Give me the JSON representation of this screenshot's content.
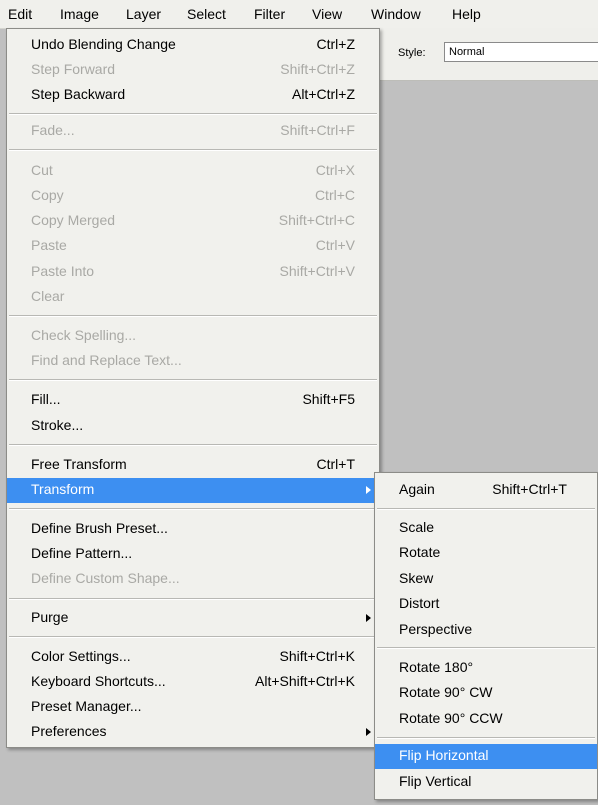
{
  "menubar": [
    "Edit",
    "Image",
    "Layer",
    "Select",
    "Filter",
    "View",
    "Window",
    "Help"
  ],
  "options": {
    "style_label": "Style:",
    "style_value": "Normal"
  },
  "edit_menu": {
    "undo": {
      "label": "Undo Blending Change",
      "shortcut": "Ctrl+Z"
    },
    "step_forward": {
      "label": "Step Forward",
      "shortcut": "Shift+Ctrl+Z"
    },
    "step_backward": {
      "label": "Step Backward",
      "shortcut": "Alt+Ctrl+Z"
    },
    "fade": {
      "label": "Fade...",
      "shortcut": "Shift+Ctrl+F"
    },
    "cut": {
      "label": "Cut",
      "shortcut": "Ctrl+X"
    },
    "copy": {
      "label": "Copy",
      "shortcut": "Ctrl+C"
    },
    "copy_merged": {
      "label": "Copy Merged",
      "shortcut": "Shift+Ctrl+C"
    },
    "paste": {
      "label": "Paste",
      "shortcut": "Ctrl+V"
    },
    "paste_into": {
      "label": "Paste Into",
      "shortcut": "Shift+Ctrl+V"
    },
    "clear": {
      "label": "Clear"
    },
    "check_spelling": {
      "label": "Check Spelling..."
    },
    "find_replace": {
      "label": "Find and Replace Text..."
    },
    "fill": {
      "label": "Fill...",
      "shortcut": "Shift+F5"
    },
    "stroke": {
      "label": "Stroke..."
    },
    "free_transform": {
      "label": "Free Transform",
      "shortcut": "Ctrl+T"
    },
    "transform": {
      "label": "Transform"
    },
    "define_brush": {
      "label": "Define Brush Preset..."
    },
    "define_pattern": {
      "label": "Define Pattern..."
    },
    "define_shape": {
      "label": "Define Custom Shape..."
    },
    "purge": {
      "label": "Purge"
    },
    "color_settings": {
      "label": "Color Settings...",
      "shortcut": "Shift+Ctrl+K"
    },
    "keyboard_shortcuts": {
      "label": "Keyboard Shortcuts...",
      "shortcut": "Alt+Shift+Ctrl+K"
    },
    "preset_manager": {
      "label": "Preset Manager..."
    },
    "preferences": {
      "label": "Preferences"
    }
  },
  "transform_menu": {
    "again": {
      "label": "Again",
      "shortcut": "Shift+Ctrl+T"
    },
    "scale": {
      "label": "Scale"
    },
    "rotate": {
      "label": "Rotate"
    },
    "skew": {
      "label": "Skew"
    },
    "distort": {
      "label": "Distort"
    },
    "perspective": {
      "label": "Perspective"
    },
    "rotate_180": {
      "label": "Rotate 180°"
    },
    "rotate_90_cw": {
      "label": "Rotate 90° CW"
    },
    "rotate_90_ccw": {
      "label": "Rotate 90° CCW"
    },
    "flip_horizontal": {
      "label": "Flip Horizontal"
    },
    "flip_vertical": {
      "label": "Flip Vertical"
    }
  },
  "colors": {
    "highlight": "#3d8ff1",
    "menu_bg": "#f1f1ed",
    "disabled_text": "#a9a9a5",
    "workspace": "#c0c0c0"
  }
}
